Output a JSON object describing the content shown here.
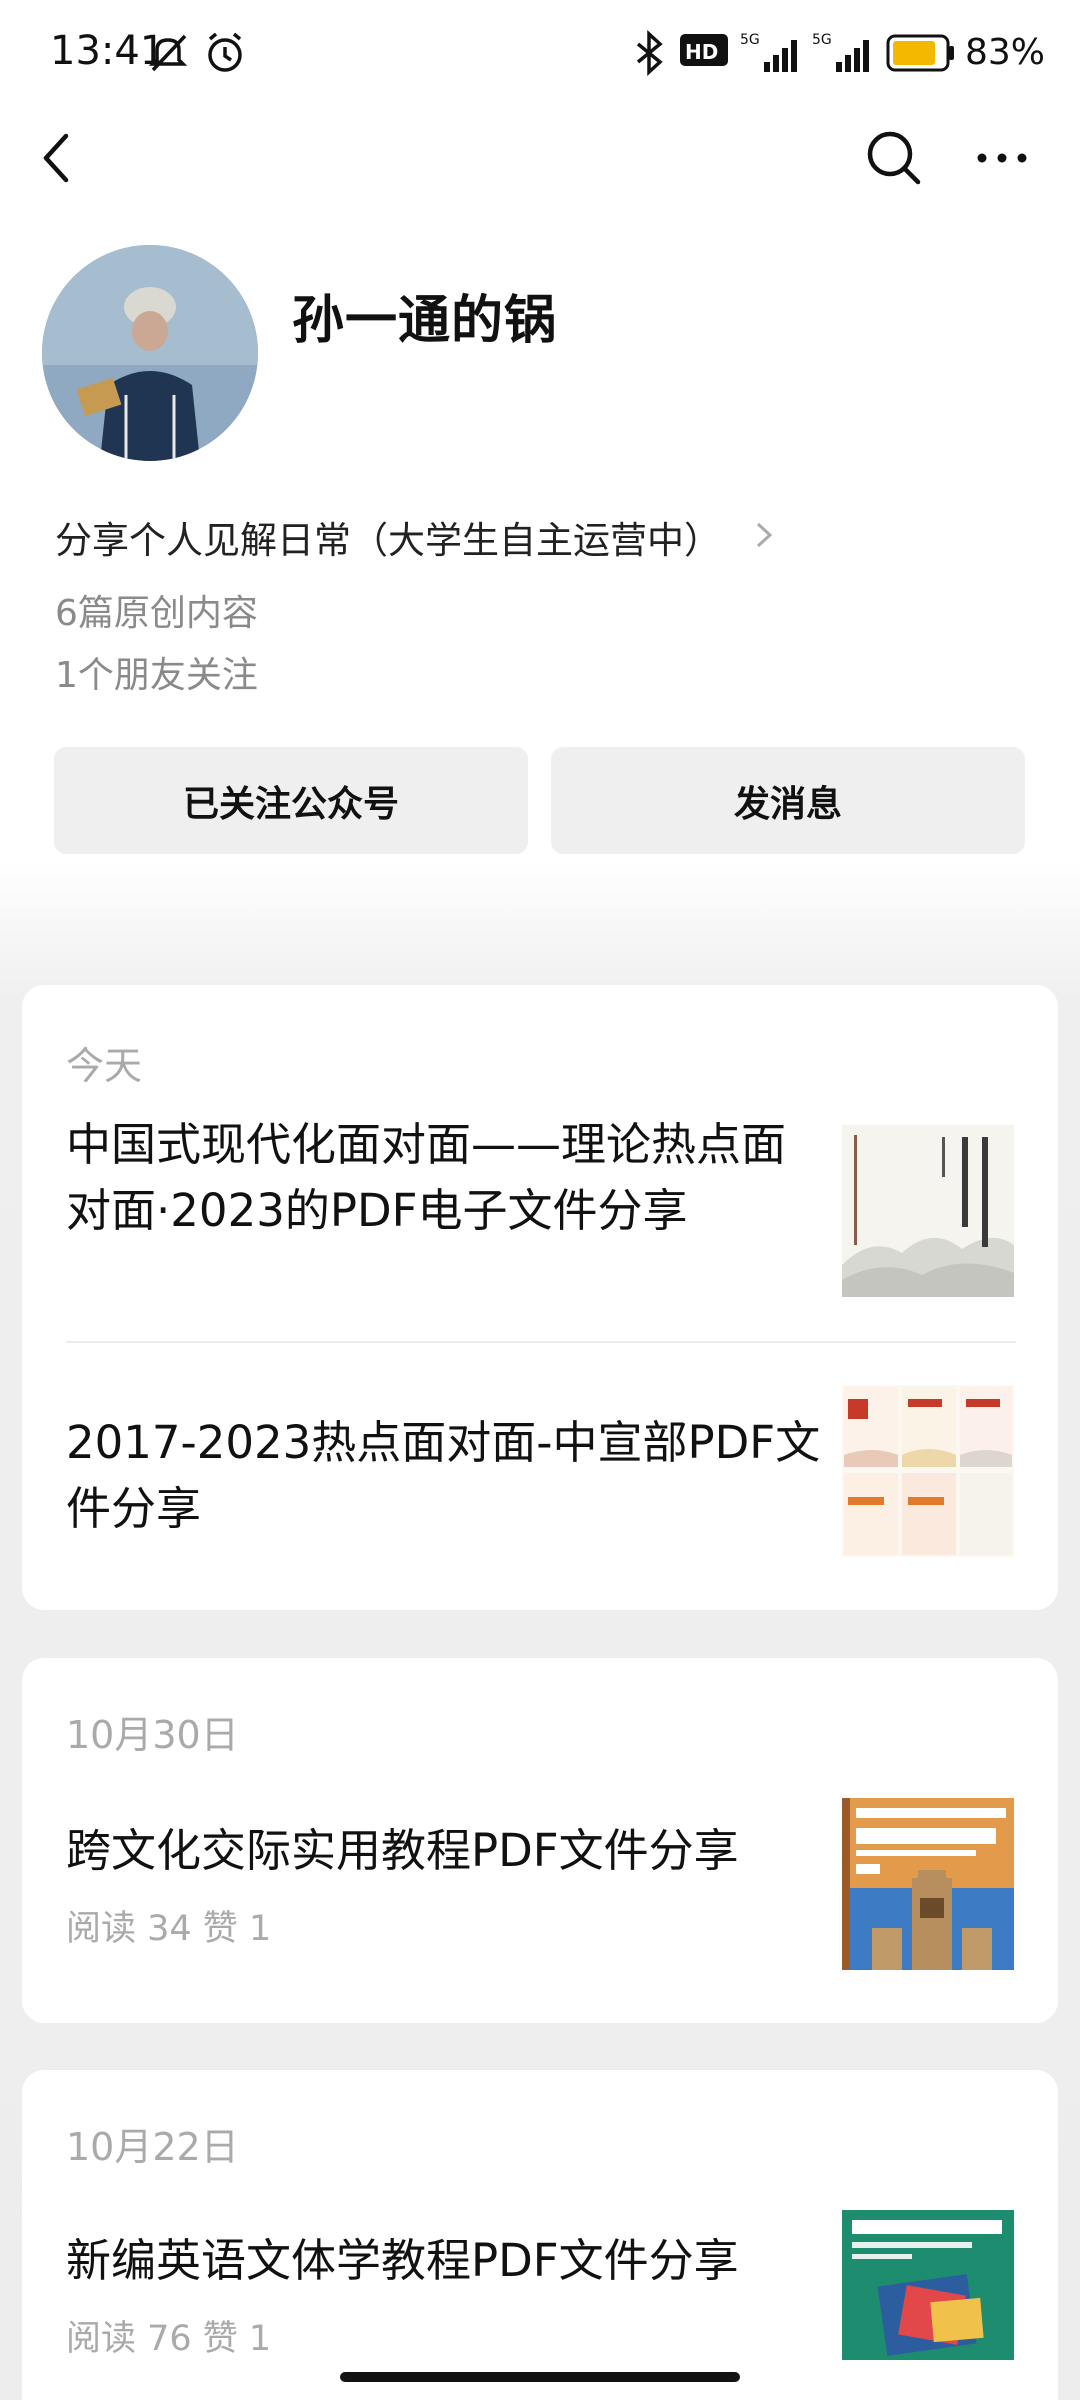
{
  "status_bar": {
    "time": "13:41",
    "icons": [
      "mute-icon",
      "alarm-icon",
      "bluetooth-icon",
      "hd-icon",
      "signal-5g-icon",
      "signal-5g-icon",
      "battery-icon"
    ],
    "battery_percent": "83%",
    "battery_color": "#f5b800"
  },
  "top_bar": {
    "back_icon": "chevron-left-icon",
    "search_icon": "search-icon",
    "more_icon": "more-horizontal-icon"
  },
  "profile": {
    "name": "孙一通的锅",
    "description": "分享个人见解日常（大学生自主运营中）",
    "original_count": "6篇原创内容",
    "friends_following": "1个朋友关注"
  },
  "actions": {
    "follow_label": "已关注公众号",
    "message_label": "发消息"
  },
  "feed": [
    {
      "date": "今天",
      "articles": [
        {
          "title": "中国式现代化面对面——理论热点面对面·2023的PDF电子文件分享"
        },
        {
          "title": "2017-2023热点面对面-中宣部PDF文件分享"
        }
      ]
    },
    {
      "date": "10月30日",
      "articles": [
        {
          "title": "跨文化交际实用教程PDF文件分享",
          "stats": "阅读 34   赞 1"
        }
      ]
    },
    {
      "date": "10月22日",
      "articles": [
        {
          "title": "新编英语文体学教程PDF文件分享",
          "stats": "阅读 76   赞 1"
        }
      ]
    }
  ]
}
